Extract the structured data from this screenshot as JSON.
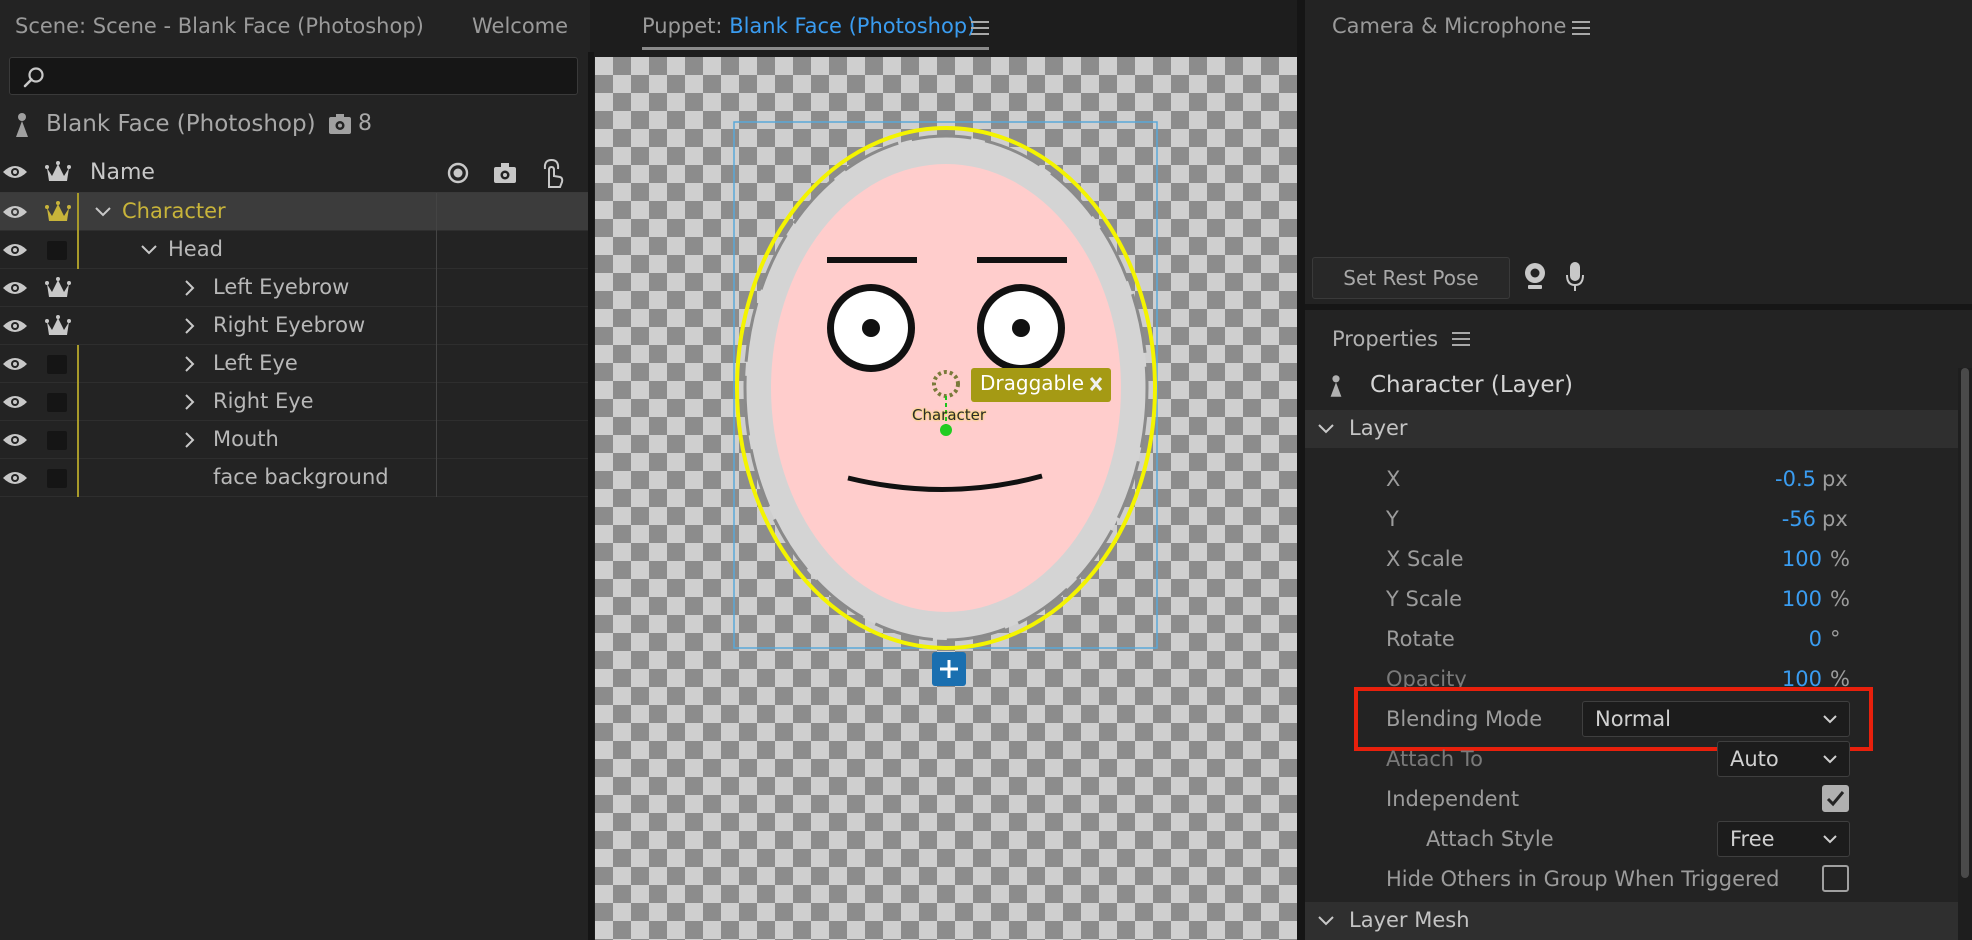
{
  "tabs": {
    "scene": "Scene: Scene - Blank Face (Photoshop)",
    "welcome": "Welcome",
    "puppet_prefix": "Puppet:",
    "puppet_name": "Blank Face (Photoshop)",
    "camera": "Camera & Microphone"
  },
  "puppet_panel": {
    "puppet_title": "Blank Face (Photoshop)",
    "behavior_count": "8",
    "column_name": "Name",
    "rows": [
      {
        "label": "Character"
      },
      {
        "label": "Head"
      },
      {
        "label": "Left Eyebrow"
      },
      {
        "label": "Right Eyebrow"
      },
      {
        "label": "Left Eye"
      },
      {
        "label": "Right Eye"
      },
      {
        "label": "Mouth"
      },
      {
        "label": "face background"
      }
    ]
  },
  "viewport": {
    "draggable_label": "Draggable",
    "origin_label": "Character"
  },
  "camera_panel": {
    "set_rest_pose": "Set Rest Pose"
  },
  "properties": {
    "header": "Properties",
    "selection": "Character (Layer)",
    "section_layer": "Layer",
    "x_label": "X",
    "x_value": "-0.5",
    "x_unit": "px",
    "y_label": "Y",
    "y_value": "-56",
    "y_unit": "px",
    "xscale_label": "X Scale",
    "xscale_value": "100",
    "xscale_unit": "%",
    "yscale_label": "Y Scale",
    "yscale_value": "100",
    "yscale_unit": "%",
    "rotate_label": "Rotate",
    "rotate_value": "0",
    "rotate_unit": "°",
    "opacity_label": "Opacity",
    "opacity_value": "100",
    "opacity_unit": "%",
    "blending_label": "Blending Mode",
    "blending_value": "Normal",
    "attach_to_label": "Attach To",
    "attach_to_value": "Auto",
    "independent_label": "Independent",
    "attach_style_label": "Attach Style",
    "attach_style_value": "Free",
    "hide_others_label": "Hide Others in Group When Triggered",
    "section_mesh": "Layer Mesh"
  },
  "colors": {
    "accent_blue": "#3a9cf0",
    "highlight_red": "#e8200c",
    "selection_gold": "#c8b43a",
    "face_pink": "#ffcdcc"
  }
}
